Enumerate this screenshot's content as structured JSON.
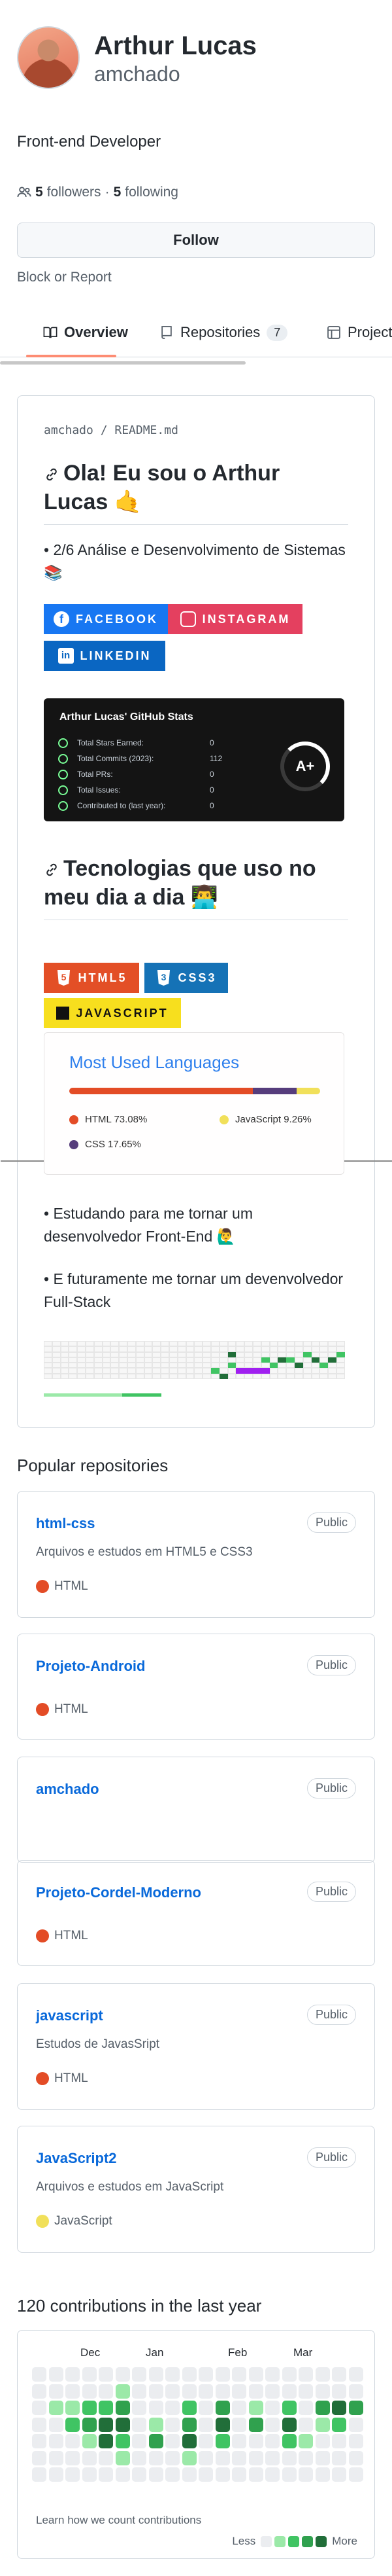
{
  "profile": {
    "name": "Arthur Lucas",
    "login": "amchado",
    "bio": "Front-end Developer",
    "followers_count": "5",
    "followers_label": "followers",
    "separator": "·",
    "following_count": "5",
    "following_label": "following",
    "follow_button": "Follow",
    "block_link": "Block or Report"
  },
  "tabs": [
    {
      "label": "Overview",
      "icon": "book-icon",
      "selected": true
    },
    {
      "label": "Repositories",
      "icon": "repo-icon",
      "count": "7"
    },
    {
      "label": "Projects",
      "icon": "table-icon"
    }
  ],
  "readme": {
    "path_user": "amchado",
    "path_sep": " / ",
    "path_file": "README.md",
    "heading1": "Ola! Eu sou o Arthur Lucas 🤙",
    "para1": "• 2/6 Análise e Desenvolvimento de Sistemas 📚",
    "social_badges": [
      {
        "label": "FACEBOOK",
        "color": "#1877f2",
        "icon": "facebook-icon"
      },
      {
        "label": "INSTAGRAM",
        "color": "#e4405f",
        "icon": "instagram-icon"
      },
      {
        "label": "LINKEDIN",
        "color": "#0a66c2",
        "icon": "linkedin-icon"
      }
    ],
    "stats": {
      "title": "Arthur Lucas' GitHub Stats",
      "rows": [
        {
          "label": "Total Stars Earned:",
          "value": "0"
        },
        {
          "label": "Total Commits (2023):",
          "value": "112"
        },
        {
          "label": "Total PRs:",
          "value": "0"
        },
        {
          "label": "Total Issues:",
          "value": "0"
        },
        {
          "label": "Contributed to (last year):",
          "value": "0"
        }
      ],
      "grade": "A+"
    },
    "heading2": "Tecnologias que uso no meu dia a dia 👨‍💻",
    "tech_badges": [
      {
        "label": "HTML5",
        "color": "#e34f26",
        "icon": "html5-icon"
      },
      {
        "label": "CSS3",
        "color": "#1572b6",
        "icon": "css3-icon"
      },
      {
        "label": "JAVASCRIPT",
        "color": "#f7df1e",
        "icon": "javascript-icon"
      }
    ],
    "languages_card": {
      "title": "Most Used Languages",
      "langs": [
        {
          "name": "HTML",
          "percent": "73.08%",
          "value": 73.08,
          "color": "#e34c26"
        },
        {
          "name": "CSS",
          "percent": "17.65%",
          "value": 17.65,
          "color": "#563d7c"
        },
        {
          "name": "JavaScript",
          "percent": "9.26%",
          "value": 9.26,
          "color": "#f1e05a"
        }
      ]
    },
    "para2": "• Estudando para me tornar um desenvolvedor Front-End 🙋‍♂️",
    "para3": "• E futuramente me tornar um devenvolvedor Full-Stack"
  },
  "popular": {
    "title": "Popular repositories",
    "repos": [
      {
        "name": "html-css",
        "visibility": "Public",
        "description": "Arquivos e estudos em HTML5 e CSS3",
        "language": "HTML",
        "lang_color": "#e34c26"
      },
      {
        "name": "Projeto-Android",
        "visibility": "Public",
        "description": "",
        "language": "HTML",
        "lang_color": "#e34c26"
      },
      {
        "name": "amchado",
        "visibility": "Public",
        "description": "",
        "language": "",
        "lang_color": ""
      },
      {
        "name": "Projeto-Cordel-Moderno",
        "visibility": "Public",
        "description": "",
        "language": "HTML",
        "lang_color": "#e34c26"
      },
      {
        "name": "javascript",
        "visibility": "Public",
        "description": "Estudos de JavasSript",
        "language": "HTML",
        "lang_color": "#e34c26"
      },
      {
        "name": "JavaScript2",
        "visibility": "Public",
        "description": "Arquivos e estudos em JavaScript",
        "language": "JavaScript",
        "lang_color": "#f1e05a"
      }
    ]
  },
  "contributions": {
    "title": "120 contributions in the last year",
    "months": [
      "Dec",
      "Jan",
      "Feb",
      "Mar"
    ],
    "learn_link": "Learn how we count contributions",
    "less": "Less",
    "more": "More",
    "levels_colors": [
      "#ebedf0",
      "#9be9a8",
      "#40c463",
      "#30a14e",
      "#216e39"
    ]
  }
}
